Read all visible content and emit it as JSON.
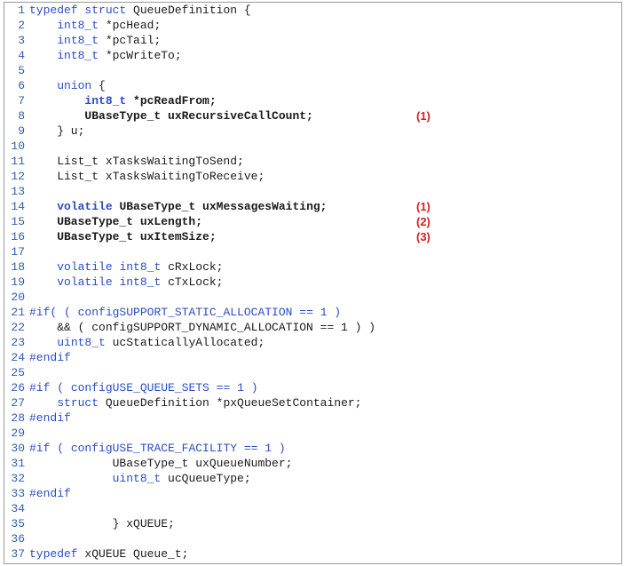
{
  "lines": [
    {
      "n": "1",
      "code": "typedef struct QueueDefinition {"
    },
    {
      "n": "2",
      "code": "    int8_t *pcHead;"
    },
    {
      "n": "3",
      "code": "    int8_t *pcTail;"
    },
    {
      "n": "4",
      "code": "    int8_t *pcWriteTo;"
    },
    {
      "n": "5",
      "code": ""
    },
    {
      "n": "6",
      "code": "    union {"
    },
    {
      "n": "7",
      "code": "        int8_t *pcReadFrom;"
    },
    {
      "n": "8",
      "code": "        UBaseType_t uxRecursiveCallCount;",
      "note": "(1)"
    },
    {
      "n": "9",
      "code": "    } u;"
    },
    {
      "n": "10",
      "code": ""
    },
    {
      "n": "11",
      "code": "    List_t xTasksWaitingToSend;"
    },
    {
      "n": "12",
      "code": "    List_t xTasksWaitingToReceive;"
    },
    {
      "n": "13",
      "code": ""
    },
    {
      "n": "14",
      "code": "    volatile UBaseType_t uxMessagesWaiting;",
      "note": "(1)"
    },
    {
      "n": "15",
      "code": "    UBaseType_t uxLength;",
      "note": "(2)"
    },
    {
      "n": "16",
      "code": "    UBaseType_t uxItemSize;",
      "note": "(3)"
    },
    {
      "n": "17",
      "code": ""
    },
    {
      "n": "18",
      "code": "    volatile int8_t cRxLock;"
    },
    {
      "n": "19",
      "code": "    volatile int8_t cTxLock;"
    },
    {
      "n": "20",
      "code": ""
    },
    {
      "n": "21",
      "code": "#if( ( configSUPPORT_STATIC_ALLOCATION == 1 )"
    },
    {
      "n": "22",
      "code": "    && ( configSUPPORT_DYNAMIC_ALLOCATION == 1 ) )"
    },
    {
      "n": "23",
      "code": "    uint8_t ucStaticallyAllocated;"
    },
    {
      "n": "24",
      "code": "#endif"
    },
    {
      "n": "25",
      "code": ""
    },
    {
      "n": "26",
      "code": "#if ( configUSE_QUEUE_SETS == 1 )"
    },
    {
      "n": "27",
      "code": "    struct QueueDefinition *pxQueueSetContainer;"
    },
    {
      "n": "28",
      "code": "#endif"
    },
    {
      "n": "29",
      "code": ""
    },
    {
      "n": "30",
      "code": "#if ( configUSE_TRACE_FACILITY == 1 )"
    },
    {
      "n": "31",
      "code": "            UBaseType_t uxQueueNumber;"
    },
    {
      "n": "32",
      "code": "            uint8_t ucQueueType;"
    },
    {
      "n": "33",
      "code": "#endif"
    },
    {
      "n": "34",
      "code": ""
    },
    {
      "n": "35",
      "code": "            } xQUEUE;"
    },
    {
      "n": "36",
      "code": ""
    },
    {
      "n": "37",
      "code": "typedef xQUEUE Queue_t;"
    }
  ]
}
